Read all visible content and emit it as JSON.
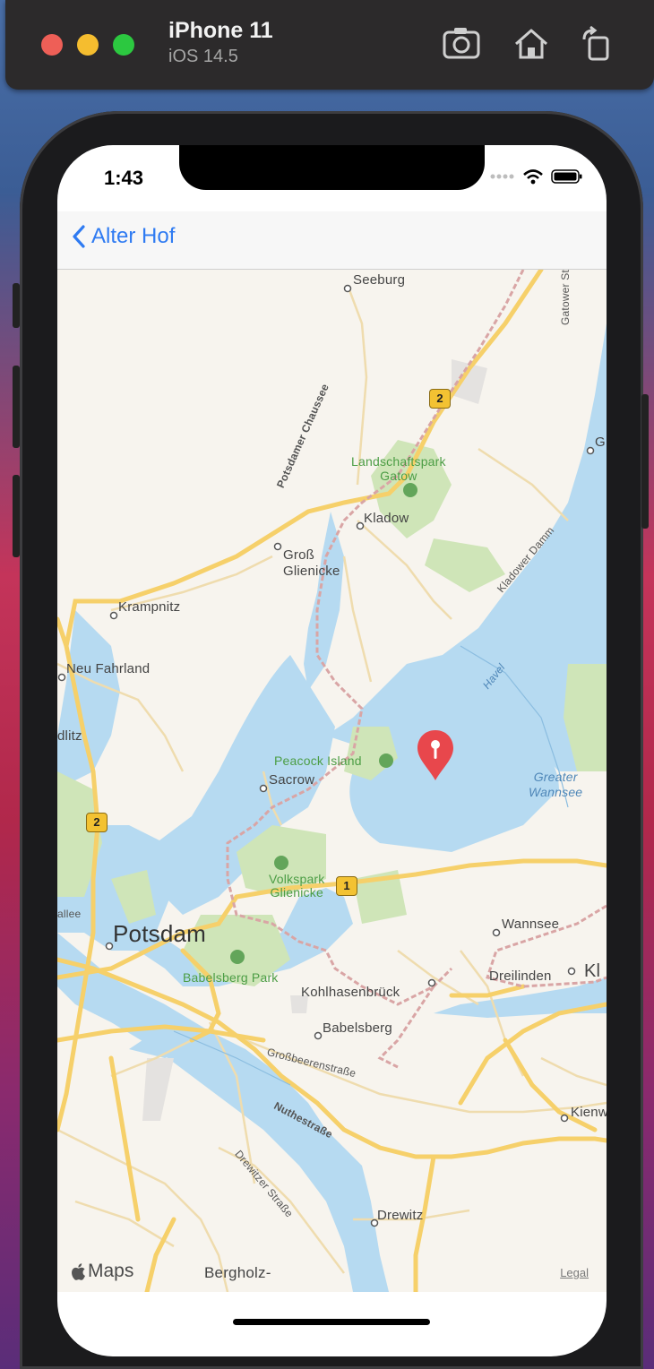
{
  "simulator": {
    "device": "iPhone 11",
    "os": "iOS 14.5",
    "toolbar_icons": [
      "screenshot-icon",
      "home-icon",
      "rotate-icon"
    ]
  },
  "status_bar": {
    "time": "1:43"
  },
  "nav": {
    "back_label": "Alter Hof"
  },
  "map": {
    "labels": {
      "seeburg": "Seeburg",
      "gatower_strasse": "Gatower Straße",
      "potsdamer_chaussee": "Potsdamer Chaussee",
      "landschaftspark": "Landschaftspark\nGatow",
      "kladow": "Kladow",
      "gross_glienicke": "Groß\nGlienicke",
      "kladower_damm": "Kladower Damm",
      "krampnitz": "Krampnitz",
      "neu_fahrland": "Neu Fahrland",
      "havel": "Havel",
      "dlitz": "dlitz",
      "peacock_island": "Peacock Island",
      "sacrow": "Sacrow",
      "greater_wannsee": "Greater\nWannsee",
      "volkspark": "Volkspark\nGlienicke",
      "allee": "allee",
      "potsdam": "Potsdam",
      "wannsee": "Wannsee",
      "dreilinden": "Dreilinden",
      "kl": "Kl",
      "babelsberg_park": "Babelsberg Park",
      "kohlhasenbrueck": "Kohlhasenbrück",
      "babelsberg": "Babelsberg",
      "grossbeerenstrasse": "Großbeerenstraße",
      "nuthestrasse": "Nuthestraße",
      "kienw": "Kienw",
      "drewitzer_strasse": "Drewitzer Straße",
      "drewitz": "Drewitz",
      "bergholz": "Bergholz-",
      "g_edge": "G"
    },
    "shields": {
      "a": "2",
      "b": "2",
      "c": "1"
    },
    "pin_icon": "map-pin-icon",
    "maps_brand": "Maps",
    "legal": "Legal"
  },
  "colors": {
    "water": "#b6daf1",
    "park": "#cfe5b8",
    "road_major": "#f6d06a",
    "road_minor": "#f0ddb0",
    "pin": "#e8474c",
    "link": "#2f7bf2"
  }
}
